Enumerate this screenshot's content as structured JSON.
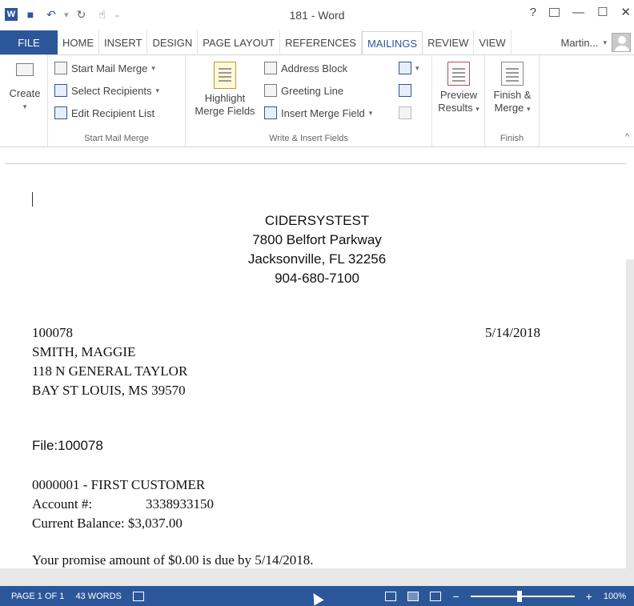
{
  "window": {
    "title": "181 - Word",
    "help": "?",
    "minimize": "—",
    "maximize": "☐",
    "close": "✕"
  },
  "qat": {
    "word_icon": "W",
    "save_icon": "■",
    "undo_icon": "↶",
    "redo_icon": "↻",
    "touch_icon": "☝",
    "customize_icon": "₌"
  },
  "tabs": {
    "file": "FILE",
    "items": [
      "HOME",
      "INSERT",
      "DESIGN",
      "PAGE LAYOUT",
      "REFERENCES",
      "MAILINGS",
      "REVIEW",
      "VIEW"
    ],
    "active": "MAILINGS",
    "user": "Martin..."
  },
  "ribbon": {
    "create": {
      "label": "Create"
    },
    "start_mail_merge": {
      "label": "Start Mail Merge",
      "start_btn": "Start Mail Merge",
      "select_btn": "Select Recipients",
      "edit_btn": "Edit Recipient List"
    },
    "write_insert": {
      "label": "Write & Insert Fields",
      "highlight_line1": "Highlight",
      "highlight_line2": "Merge Fields",
      "address_block": "Address Block",
      "greeting_line": "Greeting Line",
      "insert_merge_field": "Insert Merge Field"
    },
    "preview": {
      "label": "Preview",
      "line1": "Preview",
      "line2": "Results"
    },
    "finish": {
      "label": "Finish",
      "line1": "Finish &",
      "line2": "Merge"
    }
  },
  "document": {
    "company": {
      "name": "CIDERSYSTEST",
      "street": "7800 Belfort Parkway",
      "city": "Jacksonville, FL 32256",
      "phone": "904-680-7100"
    },
    "recipient": {
      "id": "100078",
      "name": "SMITH, MAGGIE",
      "street": "118 N GENERAL TAYLOR",
      "city": "BAY ST LOUIS, MS 39570"
    },
    "date": "5/14/2018",
    "file_line": "File:100078",
    "customer": "0000001 - FIRST CUSTOMER",
    "account_label": "Account #:",
    "account_value": "3338933150",
    "balance": "Current Balance: $3,037.00",
    "promise": "Your promise amount of $0.00 is due by 5/14/2018."
  },
  "status": {
    "page": "PAGE 1 OF 1",
    "words": "43 WORDS",
    "zoom": "100%"
  }
}
